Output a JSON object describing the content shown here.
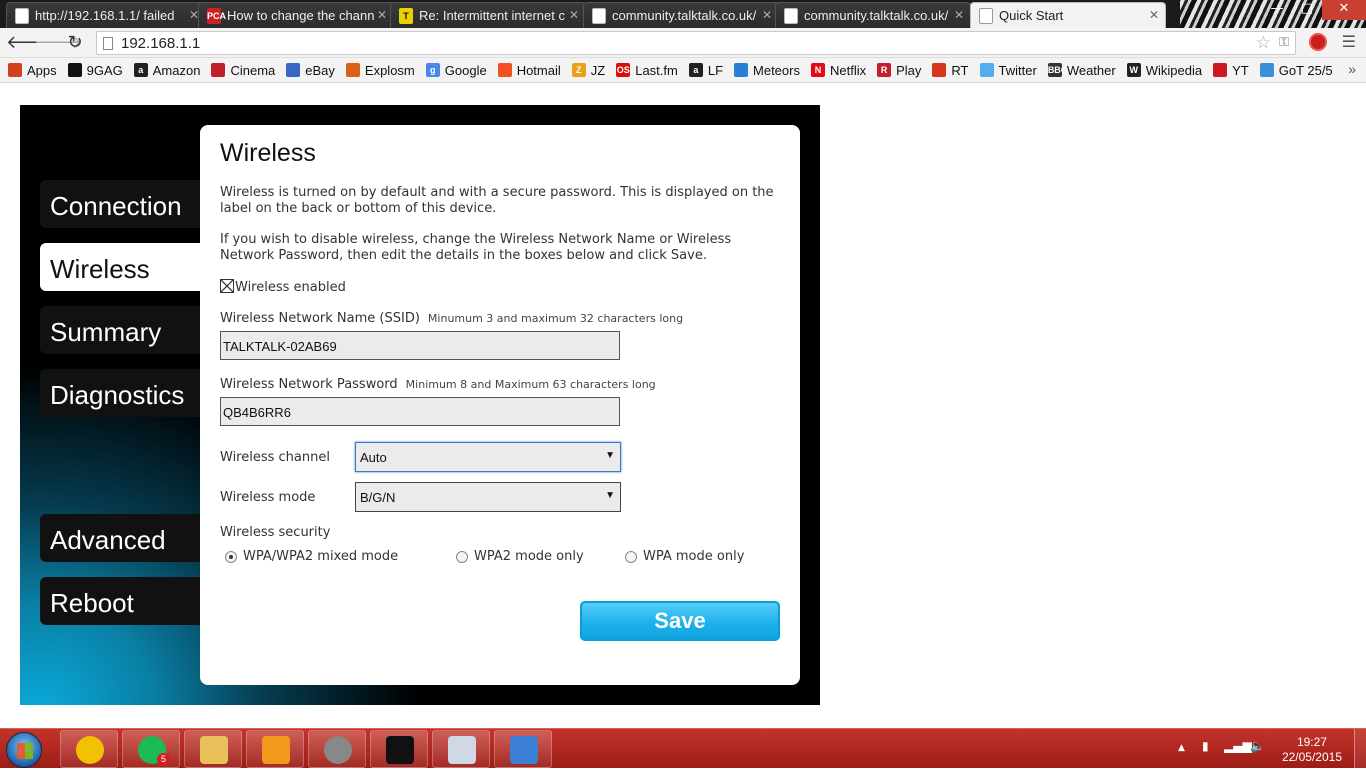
{
  "browser": {
    "tabs": [
      {
        "title": "http://192.168.1.1/ failed",
        "icon": "page-icon"
      },
      {
        "title": "How to change the chann",
        "icon": "pca-icon",
        "icon_text": "PCA",
        "icon_color": "#cc2222"
      },
      {
        "title": "Re: Intermittent internet c",
        "icon": "talktalk-icon",
        "icon_text": "T",
        "icon_color": "#222222"
      },
      {
        "title": "community.talktalk.co.uk/",
        "icon": "page-icon"
      },
      {
        "title": "community.talktalk.co.uk/",
        "icon": "page-icon"
      },
      {
        "title": "Quick Start",
        "icon": "page-icon",
        "active": true
      }
    ],
    "address": "192.168.1.1",
    "window_buttons": {
      "minimize": "—",
      "maximize": "□",
      "close": "✕"
    },
    "bookmarks": [
      {
        "label": "Apps",
        "icon": "apps-grid-icon",
        "color": "#d0421b"
      },
      {
        "label": "9GAG",
        "icon": "9gag-icon",
        "color": "#111111"
      },
      {
        "label": "Amazon",
        "icon": "amazon-icon",
        "color": "#222222",
        "text": "a"
      },
      {
        "label": "Cinema",
        "icon": "cinema-icon",
        "color": "#c0202a"
      },
      {
        "label": "eBay",
        "icon": "ebay-icon",
        "color": "#3a66c4"
      },
      {
        "label": "Explosm",
        "icon": "explosm-icon",
        "color": "#d9621a"
      },
      {
        "label": "Google",
        "icon": "google-icon",
        "color": "#4a86e8",
        "text": "g"
      },
      {
        "label": "Hotmail",
        "icon": "hotmail-icon",
        "color": "#f25022"
      },
      {
        "label": "JZ",
        "icon": "jz-icon",
        "color": "#e9a11a",
        "text": "Z"
      },
      {
        "label": "Last.fm",
        "icon": "lastfm-icon",
        "color": "#d51007",
        "text": "OS"
      },
      {
        "label": "LF",
        "icon": "lf-icon",
        "color": "#222222",
        "text": "a"
      },
      {
        "label": "Meteors",
        "icon": "meteors-icon",
        "color": "#2a7fd4"
      },
      {
        "label": "Netflix",
        "icon": "netflix-icon",
        "color": "#e50914",
        "text": "N"
      },
      {
        "label": "Play",
        "icon": "play-icon",
        "color": "#c0202a",
        "text": "R"
      },
      {
        "label": "RT",
        "icon": "rt-icon",
        "color": "#d8361b"
      },
      {
        "label": "Twitter",
        "icon": "twitter-icon",
        "color": "#55acee"
      },
      {
        "label": "Weather",
        "icon": "weather-icon",
        "color": "#333333",
        "text": "BBC"
      },
      {
        "label": "Wikipedia",
        "icon": "wikipedia-icon",
        "color": "#222222",
        "text": "W"
      },
      {
        "label": "YT",
        "icon": "youtube-icon",
        "color": "#cc181e"
      },
      {
        "label": "GoT 25/5",
        "icon": "got-icon",
        "color": "#3a8fd8"
      }
    ],
    "bookmarks_more": "»"
  },
  "router": {
    "nav": [
      {
        "label": "Connection"
      },
      {
        "label": "Wireless",
        "active": true
      },
      {
        "label": "Summary"
      },
      {
        "label": "Diagnostics"
      },
      {
        "label": "Advanced"
      },
      {
        "label": "Reboot"
      }
    ],
    "panel": {
      "title": "Wireless",
      "intro1": "Wireless is turned on by default and with a secure password. This is displayed on the label on the back or bottom of this device.",
      "intro2": "If you wish to disable wireless, change the Wireless Network Name or Wireless Network Password, then edit the details in the boxes below and click Save.",
      "wireless_enabled_label": "Wireless enabled",
      "wireless_enabled": true,
      "ssid_label": "Wireless Network Name (SSID)",
      "ssid_hint": "Minumum 3 and maximum 32 characters long",
      "ssid_value": "TALKTALK-02AB69",
      "password_label": "Wireless Network Password",
      "password_hint": "Minimum 8 and Maximum 63 characters long",
      "password_value": "QB4B6RR6",
      "channel_label": "Wireless channel",
      "channel_value": "Auto",
      "mode_label": "Wireless mode",
      "mode_value": "B/G/N",
      "security_label": "Wireless security",
      "security_options": [
        {
          "label": "WPA/WPA2 mixed mode",
          "selected": true
        },
        {
          "label": "WPA2 mode only",
          "selected": false
        },
        {
          "label": "WPA mode only",
          "selected": false
        }
      ],
      "save_label": "Save"
    }
  },
  "taskbar": {
    "apps": [
      {
        "name": "chrome",
        "color": "#f2c200"
      },
      {
        "name": "spotify",
        "color": "#1db954",
        "badge": "5"
      },
      {
        "name": "explorer",
        "color": "#e8c05a"
      },
      {
        "name": "media-player",
        "color": "#f39a1c"
      },
      {
        "name": "settings-gear",
        "color": "#888888"
      },
      {
        "name": "command-prompt",
        "color": "#111111"
      },
      {
        "name": "paint",
        "color": "#cfd9e6"
      },
      {
        "name": "cube-app",
        "color": "#3b7fd6"
      }
    ],
    "time": "19:27",
    "date": "22/05/2015"
  }
}
